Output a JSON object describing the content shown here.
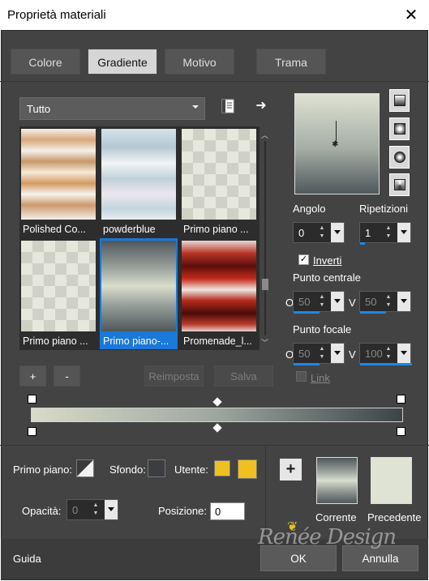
{
  "window": {
    "title": "Proprietà materiali",
    "close_glyph": "✕"
  },
  "tabs": [
    {
      "label": "Colore",
      "active": false
    },
    {
      "label": "Gradiente",
      "active": true
    },
    {
      "label": "Motivo",
      "active": false
    },
    {
      "label": "Trama",
      "active": false
    }
  ],
  "preset": {
    "category": "Tutto"
  },
  "gallery": {
    "items": [
      {
        "label": "Polished Co...",
        "selected": false
      },
      {
        "label": "powderblue",
        "selected": false
      },
      {
        "label": "Primo piano ...",
        "selected": false
      },
      {
        "label": "Primo piano ...",
        "selected": false
      },
      {
        "label": "Primo piano-...",
        "selected": true
      },
      {
        "label": "Promenade_l...",
        "selected": false
      }
    ]
  },
  "buttons": {
    "add": "+",
    "remove": "-",
    "reset": "Reimposta",
    "save": "Salva"
  },
  "gradient_stops": {
    "colors": [
      "#d8dbc9",
      "#9ea6a0",
      "#3b4448"
    ]
  },
  "right": {
    "angle_label": "Angolo",
    "angle_value": "0",
    "repeats_label": "Ripetizioni",
    "repeats_value": "1",
    "invert_label": "Inverti",
    "invert_checked": true,
    "center_label": "Punto centrale",
    "center_o_label": "O",
    "center_o_value": "50",
    "center_v_label": "V",
    "center_v_value": "50",
    "focal_label": "Punto focale",
    "focal_o_label": "O",
    "focal_o_value": "50",
    "focal_v_label": "V",
    "focal_v_value": "100",
    "link_label": "Link",
    "link_checked": false
  },
  "bottom": {
    "foreground_label": "Primo piano:",
    "background_label": "Sfondo:",
    "user_label": "Utente:",
    "user_color": "#f0c020",
    "opacity_label": "Opacità:",
    "opacity_value": "0",
    "position_label": "Posizione:",
    "position_value": "0",
    "current_label": "Corrente",
    "previous_label": "Precedente",
    "add_glyph": "+"
  },
  "footer": {
    "help": "Guida",
    "ok": "OK",
    "cancel": "Annulla",
    "watermark": "Renée Design"
  }
}
